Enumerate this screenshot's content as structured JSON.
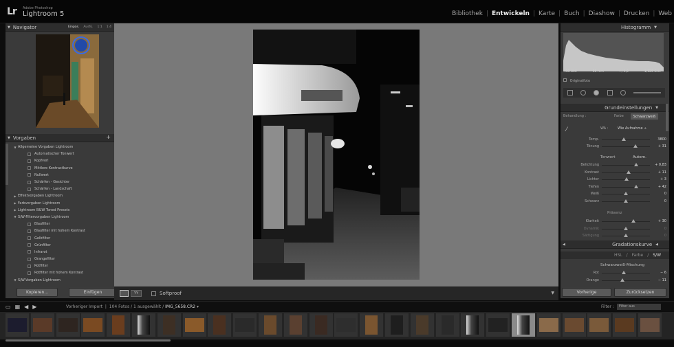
{
  "app": {
    "logo": "Lr",
    "brand_small": "Adobe Photoshop",
    "brand_title": "Lightroom 5"
  },
  "modules": [
    {
      "label": "Bibliothek",
      "active": false
    },
    {
      "label": "Entwickeln",
      "active": true
    },
    {
      "label": "Karte",
      "active": false
    },
    {
      "label": "Buch",
      "active": false
    },
    {
      "label": "Diashow",
      "active": false
    },
    {
      "label": "Drucken",
      "active": false
    },
    {
      "label": "Web",
      "active": false
    }
  ],
  "left_panel": {
    "navigator_title": "Navigator",
    "navigator_options": [
      "Einpas.",
      "Ausfü.",
      "1:1",
      "1:4"
    ],
    "presets_title": "Vorgaben",
    "presets": [
      {
        "label": "Allgemeine Vorgaben Lightroom",
        "level": 0,
        "open": true
      },
      {
        "label": "Automatischer Tonwert",
        "level": 1
      },
      {
        "label": "Kopfvorl",
        "level": 1
      },
      {
        "label": "Mittlere Kontrastkurve",
        "level": 1
      },
      {
        "label": "Nullwert",
        "level": 1
      },
      {
        "label": "Schärfen - Gesichter",
        "level": 1
      },
      {
        "label": "Schärfen - Landschaft",
        "level": 1
      },
      {
        "label": "Effektvorgaben Lightroom",
        "level": 0,
        "open": false
      },
      {
        "label": "Farbvorgaben Lightroom",
        "level": 0,
        "open": false
      },
      {
        "label": "Lightroom B&W Toned Presets",
        "level": 0,
        "open": false
      },
      {
        "label": "S/W-Filtervorgaben Lightroom",
        "level": 0,
        "open": true
      },
      {
        "label": "Blaufilter",
        "level": 1
      },
      {
        "label": "Blaufilter mit hohem Kontrast",
        "level": 1
      },
      {
        "label": "Gelbfilter",
        "level": 1
      },
      {
        "label": "Grünfilter",
        "level": 1
      },
      {
        "label": "Infrarot",
        "level": 1
      },
      {
        "label": "Orangefilter",
        "level": 1
      },
      {
        "label": "Rotfilter",
        "level": 1
      },
      {
        "label": "Rotfilter mit hohem Kontrast",
        "level": 1
      },
      {
        "label": "S/W-Vorgaben Lightroom",
        "level": 0,
        "open": true
      }
    ],
    "copy_button": "Kopieren...",
    "paste_button": "Einfügen"
  },
  "toolbar": {
    "softproof": "Softproof"
  },
  "right_panel": {
    "histogram_title": "Histogramm",
    "histogram_readout": [
      "ISO 800",
      "55 mm",
      "f / 4,0",
      "1/125 Sek."
    ],
    "original_photo": "Originalfoto",
    "basic_title": "Grundeinstellungen",
    "treatment_label": "Behandlung :",
    "treatment_color": "Farbe",
    "treatment_bw": "Schwarzweiß",
    "wb_label": "WA :",
    "wb_value": "Wie Aufnahme ÷",
    "temp": {
      "label": "Temp.",
      "value": "3800",
      "pos": 0.45
    },
    "tint": {
      "label": "Tönung",
      "value": "+ 31",
      "pos": 0.7
    },
    "tone_label": "Tonwert",
    "auto_label": "Autom.",
    "sliders_tone": [
      {
        "label": "Belichtung",
        "value": "+ 0,83",
        "pos": 0.72
      },
      {
        "label": "Kontrast",
        "value": "+ 11",
        "pos": 0.56
      },
      {
        "label": "Lichter",
        "value": "+ 3",
        "pos": 0.52
      },
      {
        "label": "Tiefen",
        "value": "+ 42",
        "pos": 0.71
      },
      {
        "label": "Weiß",
        "value": "0",
        "pos": 0.5
      },
      {
        "label": "Schwarz",
        "value": "0",
        "pos": 0.5
      }
    ],
    "presence_label": "Präsenz",
    "sliders_presence": [
      {
        "label": "Klarheit",
        "value": "+ 30",
        "pos": 0.65,
        "dim": false
      },
      {
        "label": "Dynamik",
        "value": "0",
        "pos": 0.5,
        "dim": true
      },
      {
        "label": "Sättigung",
        "value": "0",
        "pos": 0.5,
        "dim": true
      }
    ],
    "tone_curve_title": "Gradationskurve",
    "hsl_tabs": [
      "HSL",
      "/",
      "Farbe",
      "/",
      "S/W"
    ],
    "bw_mix_label": "Schwarzweiß-Mischung",
    "sliders_mix": [
      {
        "label": "Rot",
        "value": "− 6",
        "pos": 0.46
      },
      {
        "label": "Orange",
        "value": "− 11",
        "pos": 0.43
      }
    ],
    "prev_button": "Vorherige",
    "reset_button": "Zurücksetzen"
  },
  "filmstrip": {
    "source_prefix": "Vorheriger Import",
    "count": "104 Fotos / 1 ausgewählt /",
    "filename": "IMG_5658.CR2",
    "filter_label": "Filter :",
    "filter_value": "Filter aus",
    "selected_index": 20
  },
  "colors": {
    "accent_active": "#ededed",
    "panel": "#3a3a3a",
    "center": "#797979"
  }
}
